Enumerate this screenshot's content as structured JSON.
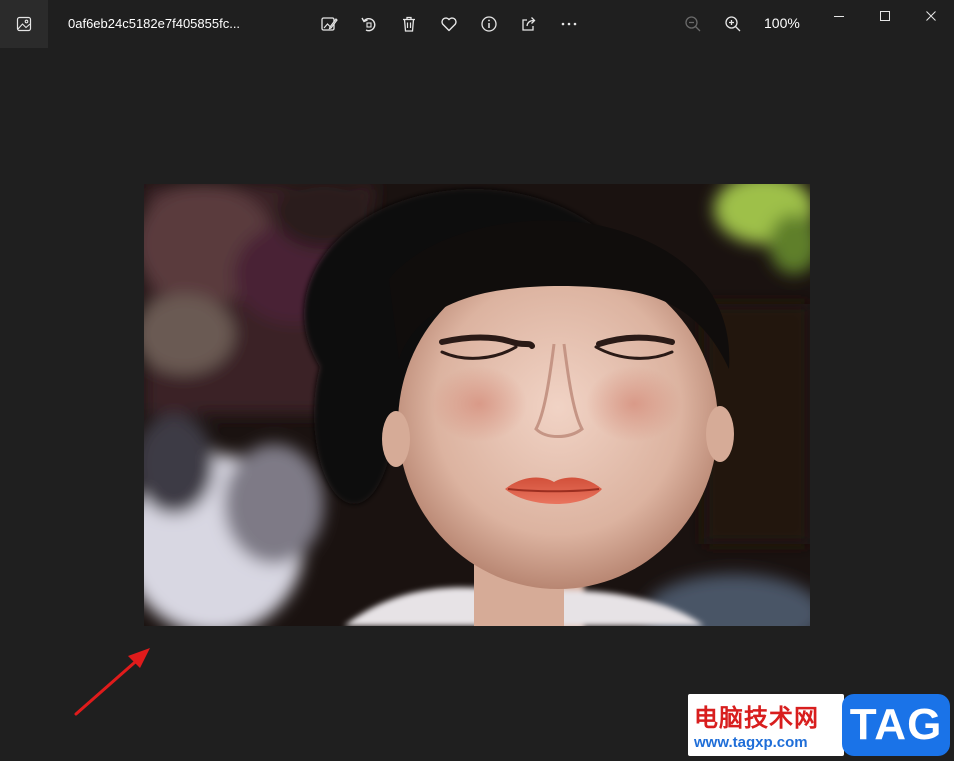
{
  "titlebar": {
    "file_name": "0af6eb24c5182e7f405855fc...",
    "app_icon": "photo-app-icon"
  },
  "toolbar": {
    "icons": [
      "edit-image-icon",
      "rotate-icon",
      "delete-icon",
      "favorite-icon",
      "info-icon",
      "share-icon",
      "more-icon"
    ],
    "zoom_out_icon": "zoom-out-icon",
    "zoom_in_icon": "zoom-in-icon",
    "zoom_level": "100%"
  },
  "window_controls": {
    "icons": [
      "minimize-icon",
      "maximize-icon",
      "close-icon"
    ]
  },
  "watermark": {
    "site_name": "电脑技术网",
    "url": "www.tagxp.com",
    "tag": "TAG"
  },
  "colors": {
    "background": "#1f1f1f",
    "annotation_arrow": "#e01b1b",
    "watermark_red": "#d81e1e",
    "watermark_blue": "#1a73e8"
  }
}
